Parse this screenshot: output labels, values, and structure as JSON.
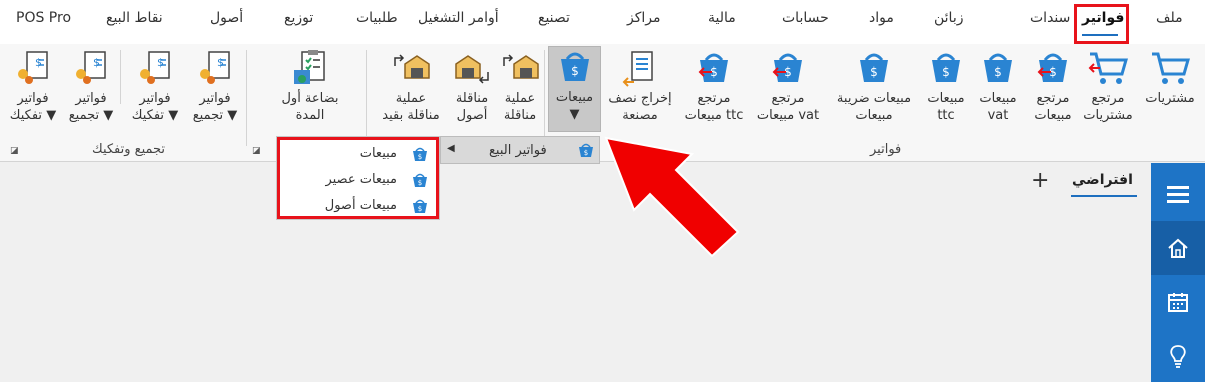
{
  "tabs": [
    {
      "id": "file",
      "label": "ملف"
    },
    {
      "id": "invoices",
      "label": "فواتير",
      "active": true
    },
    {
      "id": "vouchers",
      "label": "سندات"
    },
    {
      "id": "customers",
      "label": "زبائن"
    },
    {
      "id": "materials",
      "label": "مواد"
    },
    {
      "id": "accounts",
      "label": "حسابات"
    },
    {
      "id": "finance",
      "label": "مالية"
    },
    {
      "id": "centers",
      "label": "مراكز"
    },
    {
      "id": "manufacturing",
      "label": "تصنيع"
    },
    {
      "id": "work-orders",
      "label": "أوامر التشغيل"
    },
    {
      "id": "requests",
      "label": "طلبيات"
    },
    {
      "id": "distribution",
      "label": "توزيع"
    },
    {
      "id": "assets",
      "label": "أصول"
    },
    {
      "id": "pos",
      "label": "نقاط البيع"
    },
    {
      "id": "pos-pro",
      "label": "POS Pro"
    }
  ],
  "ribbon": {
    "invoices_group": {
      "label": "فواتير",
      "buttons": [
        {
          "line1": "مشتريات",
          "line2": ""
        },
        {
          "line1": "مرتجع",
          "line2": "مشتريات"
        },
        {
          "line1": "مرتجع",
          "line2": "مبيعات"
        },
        {
          "line1": "مبيعات",
          "line2": "vat"
        },
        {
          "line1": "مبيعات",
          "line2": "ttc"
        },
        {
          "line1": "مبيعات ضريبة",
          "line2": "مبيعات"
        },
        {
          "line1": "مرتجع",
          "line2": "مبيعات vat"
        },
        {
          "line1": "مرتجع",
          "line2": "مبيعات ttc"
        },
        {
          "line1": "إخراج نصف",
          "line2": "مصنعة"
        },
        {
          "line1": "مبيعات",
          "line2": "▼"
        }
      ]
    },
    "assets_group": {
      "buttons": [
        {
          "line1": "عملية",
          "line2": "مناقلة"
        },
        {
          "line1": "مناقلة",
          "line2": "أصول"
        },
        {
          "line1": "عملية",
          "line2": "مناقلة بقيد"
        }
      ]
    },
    "opening_group": {
      "buttons": [
        {
          "line1": "بضاعة أول",
          "line2": "المدة"
        }
      ]
    },
    "assembly_group": {
      "label": "تجميع وتفكيك",
      "buttons": [
        {
          "line1": "فواتير",
          "line2": "تجميع ▼"
        },
        {
          "line1": "فواتير",
          "line2": "تفكيك ▼"
        },
        {
          "line1": "فواتير",
          "line2": "تجميع ▼"
        },
        {
          "line1": "فواتير",
          "line2": "تفكيك ▼"
        }
      ]
    }
  },
  "submenu": {
    "label": "فواتير البيع",
    "items": [
      "مبيعات",
      "مبيعات عصير",
      "مبيعات أصول"
    ]
  },
  "workspace": {
    "tab_label": "افتراضي",
    "add_label": "+"
  },
  "colors": {
    "accent": "#1e74c6",
    "highlight": "#e8131b",
    "icon_blue": "#2a84d2"
  }
}
